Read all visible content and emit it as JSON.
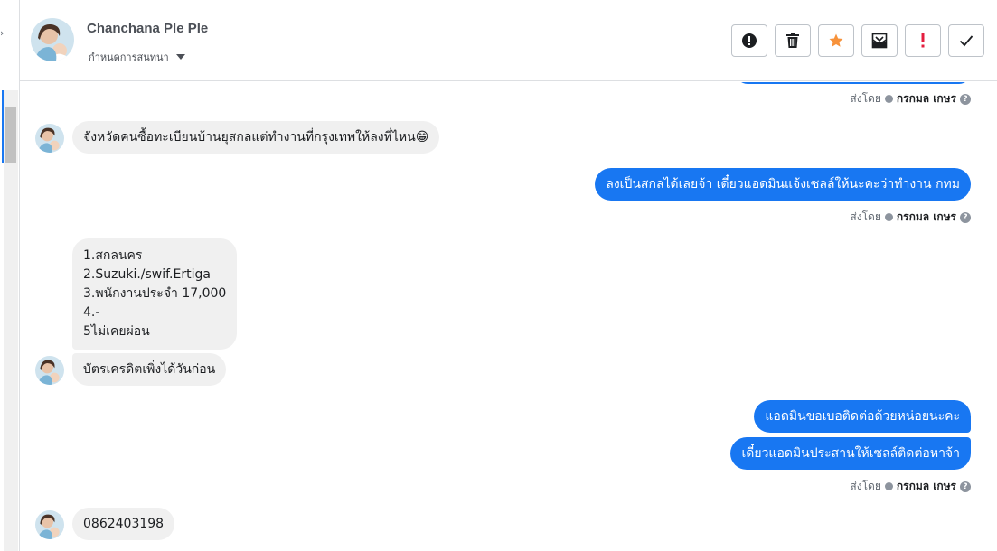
{
  "header": {
    "name": "Chanchana Ple Ple",
    "assign_label": "กำหนดการสนทนา"
  },
  "actions": [
    {
      "icon": "alert-circle-icon"
    },
    {
      "icon": "trash-icon"
    },
    {
      "icon": "star-icon",
      "color": "#f7923b"
    },
    {
      "icon": "mail-archive-icon"
    },
    {
      "icon": "exclamation-icon",
      "color": "#e41e3f"
    },
    {
      "icon": "check-icon"
    }
  ],
  "sent_by": {
    "prefix": "ส่งโดย",
    "name": "กรกมล เกษร"
  },
  "messages": {
    "in_1": "จังหวัดคนซื้อทะเบียนบ้านยุสกลแต่ทำงานที่กรุงเทพให้ลงที่ไหน😁",
    "out_1": "ลงเป็นสกลได้เลยจ้า เดี๋ยวแอดมินแจ้งเซลล์ให้นะคะว่าทำงาน กทม",
    "in_2_lines": [
      "1.สกลนคร",
      "2.Suzuki./swif.Ertiga",
      "3.พนักงานประจำ 17,000",
      "4.-",
      "5ไม่เคยผ่อน"
    ],
    "in_3": "บัตรเครดิตเพิ่งได้วันก่อน",
    "out_2": "แอดมินขอเบอติดต่อด้วยหน่อยนะคะ",
    "out_3": "เดี๋ยวแอดมินประสานให้เซลล์ติดต่อหาจ้า",
    "in_4": "0862403198"
  },
  "colors": {
    "brand": "#1877f2",
    "incoming_bg": "#f0f0f0"
  }
}
